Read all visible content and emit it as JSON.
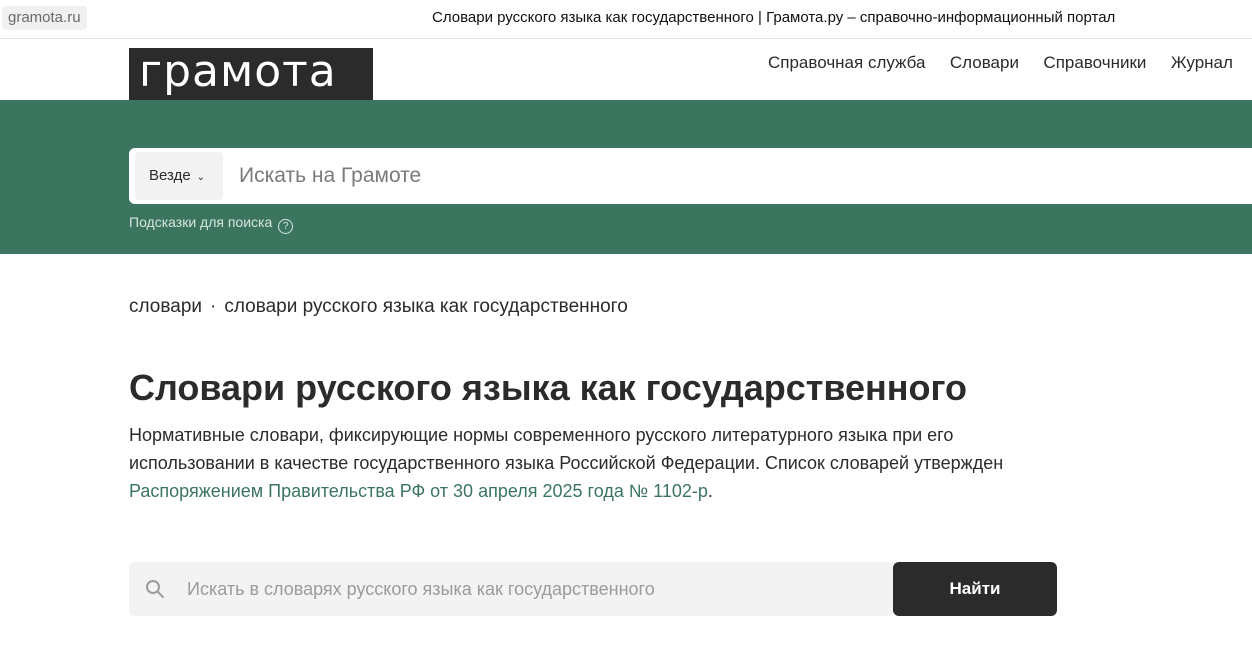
{
  "browser": {
    "domain": "gramota.ru",
    "tab_title": "Словари русского языка как государственного | Грамота.ру – справочно-информационный портал"
  },
  "header": {
    "logo": "грамота",
    "nav": [
      {
        "label": "Справочная служба"
      },
      {
        "label": "Словари"
      },
      {
        "label": "Справочники"
      },
      {
        "label": "Журнал"
      }
    ]
  },
  "search": {
    "scope_label": "Везде",
    "placeholder": "Искать на Грамоте",
    "hints_label": "Подсказки для поиска",
    "hints_icon": "question-circle-icon"
  },
  "breadcrumb": {
    "items": [
      "словари",
      "словари русского языка как государственного"
    ],
    "separator": "·"
  },
  "page": {
    "title": "Словари русского языка как государственного",
    "desc_text": "Нормативные словари, фиксирующие нормы современного русского литературного языка при его использовании в качестве государственного языка Российской Федерации. Список словарей утвержден ",
    "desc_link": "Распоряжением Правительства РФ от 30 апреля 2025 года № 1102-р",
    "desc_end": "."
  },
  "dict_search": {
    "placeholder": "Искать в словарях русского языка как государственного",
    "button_label": "Найти"
  },
  "colors": {
    "brand_green": "#3b7560",
    "dark": "#2b2b2b"
  }
}
